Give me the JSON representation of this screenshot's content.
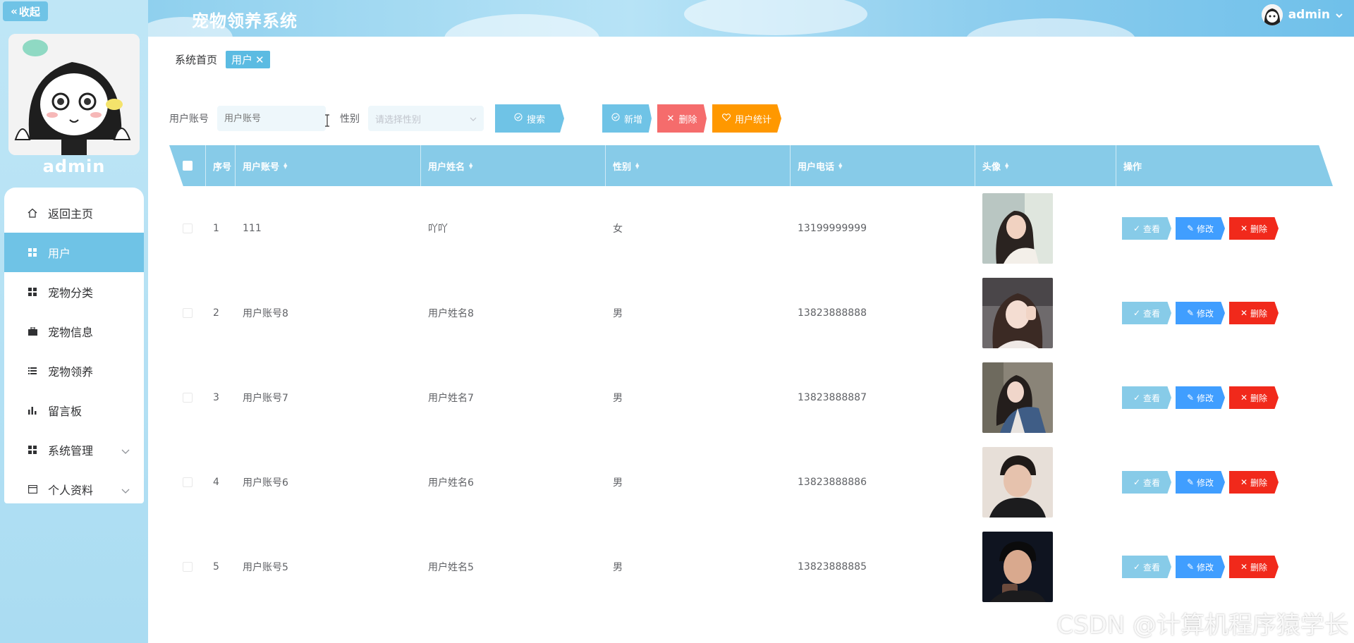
{
  "sidebar": {
    "collapse_label": "收起",
    "admin_name": "admin",
    "items": [
      {
        "label": "返回主页",
        "icon": "home-icon"
      },
      {
        "label": "用户",
        "icon": "grid-icon"
      },
      {
        "label": "宠物分类",
        "icon": "grid-icon"
      },
      {
        "label": "宠物信息",
        "icon": "briefcase-icon"
      },
      {
        "label": "宠物领养",
        "icon": "list-icon"
      },
      {
        "label": "留言板",
        "icon": "bar-chart-icon"
      },
      {
        "label": "系统管理",
        "icon": "grid-icon"
      },
      {
        "label": "个人资料",
        "icon": "id-card-icon"
      }
    ]
  },
  "header": {
    "title": "宠物领养系统",
    "user": "admin"
  },
  "breadcrumb": {
    "home": "系统首页",
    "current": "用户"
  },
  "search": {
    "account_label": "用户账号",
    "account_placeholder": "用户账号",
    "gender_label": "性别",
    "gender_placeholder": "请选择性别",
    "search_btn": "搜索",
    "add_btn": "新增",
    "delete_btn": "删除",
    "stat_btn": "用户统计"
  },
  "table": {
    "headers": {
      "index": "序号",
      "account": "用户账号",
      "name": "用户姓名",
      "gender": "性别",
      "phone": "用户电话",
      "avatar": "头像",
      "actions": "操作"
    },
    "rows": [
      {
        "index": "1",
        "account": "111",
        "name": "吖吖",
        "gender": "女",
        "phone": "13199999999"
      },
      {
        "index": "2",
        "account": "用户账号8",
        "name": "用户姓名8",
        "gender": "男",
        "phone": "13823888888"
      },
      {
        "index": "3",
        "account": "用户账号7",
        "name": "用户姓名7",
        "gender": "男",
        "phone": "13823888887"
      },
      {
        "index": "4",
        "account": "用户账号6",
        "name": "用户姓名6",
        "gender": "男",
        "phone": "13823888886"
      },
      {
        "index": "5",
        "account": "用户账号5",
        "name": "用户姓名5",
        "gender": "男",
        "phone": "13823888885"
      }
    ],
    "op_view": "查看",
    "op_edit": "修改",
    "op_delete": "删除"
  },
  "watermark": "CSDN @计算机程序猿学长"
}
